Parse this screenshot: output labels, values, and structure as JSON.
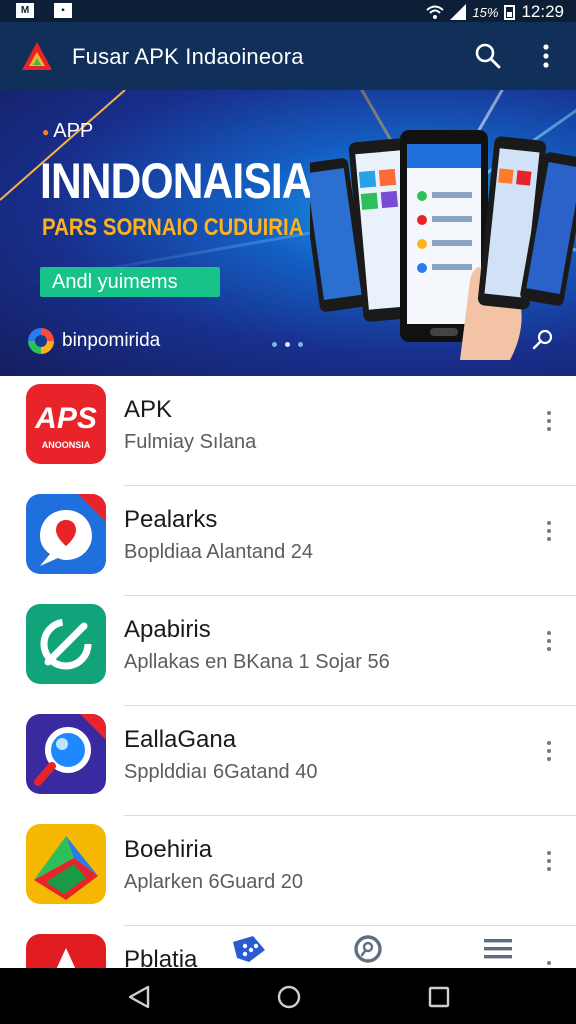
{
  "status_bar": {
    "battery_percent": "15%",
    "time": "12:29",
    "left_icons": [
      "notification-m-icon",
      "notification-square-icon"
    ]
  },
  "app_bar": {
    "title": "Fusar APK Indaoineora",
    "actions": [
      "search-icon",
      "more-vert-icon"
    ]
  },
  "banner": {
    "eyebrow": "APP",
    "title": "INNDONAISIA",
    "subtitle": "PARS SORNAIO CUDUIRIA",
    "cta_label": "Andl yuimems",
    "brand": "binpomirida",
    "dots_total": 3,
    "dots_active": 1
  },
  "apps": [
    {
      "name": "APK",
      "desc": "Fulmiay Sılana",
      "icon": "aps-red-icon",
      "icon_text": "APS",
      "icon_subtext": "ANOONSIA",
      "color": "#e8232a"
    },
    {
      "name": "Pealarks",
      "desc": "Bopldiaa Alantand 24",
      "icon": "chat-pin-blue-icon",
      "color": "#1f6fdc"
    },
    {
      "name": "Apabiris",
      "desc": "Apllakas en BKana 1 Sojar 56",
      "icon": "sync-green-icon",
      "color": "#11a37a"
    },
    {
      "name": "EallaGana",
      "desc": "Spplddiaı 6Gatand 40",
      "icon": "magnifier-purple-icon",
      "color": "#3a2aa0"
    },
    {
      "name": "Boehiria",
      "desc": "Aplarken 6Guard 20",
      "icon": "colorful-arrows-icon",
      "color": "#f5b800"
    },
    {
      "name": "Pblatia",
      "desc": "",
      "icon": "adobe-red-icon",
      "color": "#e11d22"
    }
  ],
  "bottom_tabs": [
    "dots-tag-icon",
    "search-circle-icon",
    "menu-lines-icon"
  ],
  "nav_bar": [
    "back-triangle-icon",
    "home-circle-icon",
    "recents-square-icon"
  ],
  "colors": {
    "status_bar": "#0d1f36",
    "app_bar": "#10305a",
    "accent_green": "#18c38a",
    "accent_orange": "#ffb21e"
  }
}
